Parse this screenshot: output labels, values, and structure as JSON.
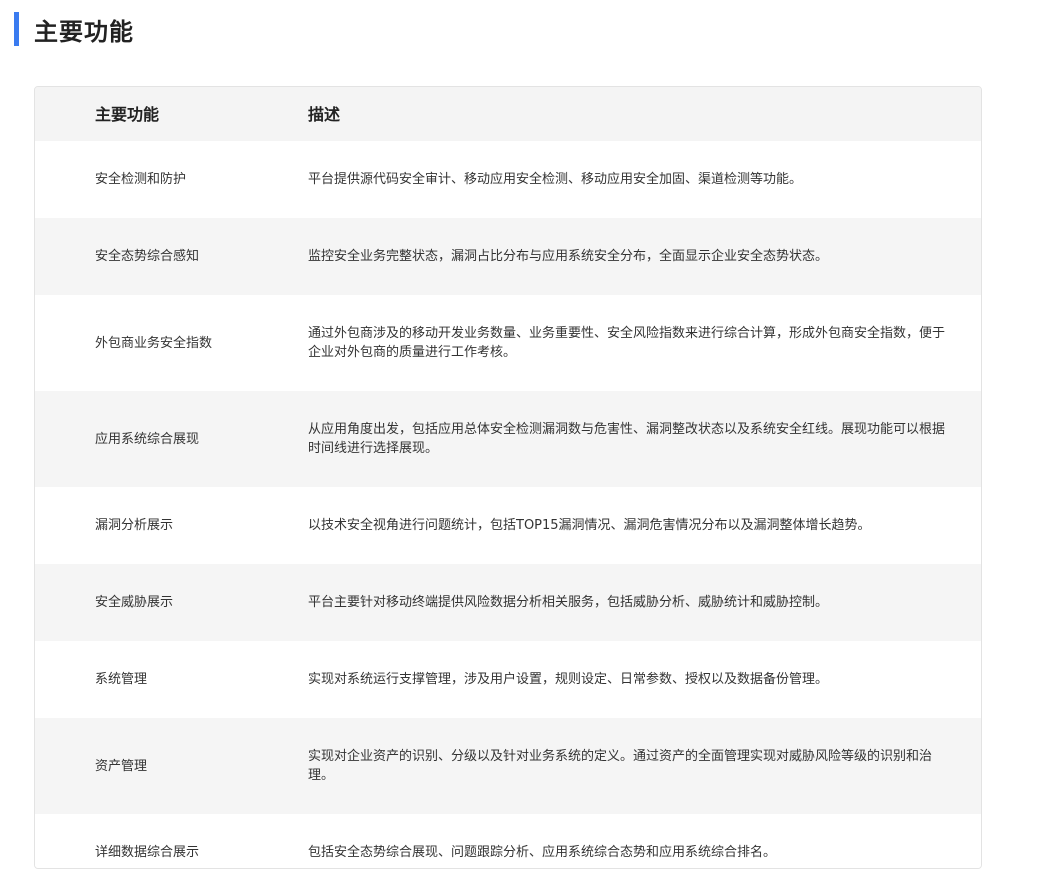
{
  "section": {
    "title": "主要功能"
  },
  "table": {
    "headers": [
      "主要功能",
      "描述"
    ],
    "rows": [
      {
        "feature": "安全检测和防护",
        "description": "平台提供源代码安全审计、移动应用安全检测、移动应用安全加固、渠道检测等功能。"
      },
      {
        "feature": "安全态势综合感知",
        "description": "监控安全业务完整状态，漏洞占比分布与应用系统安全分布，全面显示企业安全态势状态。"
      },
      {
        "feature": "外包商业务安全指数",
        "description": "通过外包商涉及的移动开发业务数量、业务重要性、安全风险指数来进行综合计算，形成外包商安全指数，便于企业对外包商的质量进行工作考核。"
      },
      {
        "feature": "应用系统综合展现",
        "description": "从应用角度出发，包括应用总体安全检测漏洞数与危害性、漏洞整改状态以及系统安全红线。展现功能可以根据时间线进行选择展现。"
      },
      {
        "feature": "漏洞分析展示",
        "description": "以技术安全视角进行问题统计，包括TOP15漏洞情况、漏洞危害情况分布以及漏洞整体增长趋势。"
      },
      {
        "feature": "安全威胁展示",
        "description": "平台主要针对移动终端提供风险数据分析相关服务，包括威胁分析、威胁统计和威胁控制。"
      },
      {
        "feature": "系统管理",
        "description": "实现对系统运行支撑管理，涉及用户设置，规则设定、日常参数、授权以及数据备份管理。"
      },
      {
        "feature": "资产管理",
        "description": "实现对企业资产的识别、分级以及针对业务系统的定义。通过资产的全面管理实现对威胁风险等级的识别和治理。"
      },
      {
        "feature": "详细数据综合展示",
        "description": "包括安全态势综合展现、问题跟踪分析、应用系统综合态势和应用系统综合排名。"
      }
    ]
  },
  "colors": {
    "accent": "#3a7bf0",
    "header_bg": "#f4f4f4",
    "row_alt_bg": "#f5f5f5",
    "border": "#e3e3e3"
  }
}
